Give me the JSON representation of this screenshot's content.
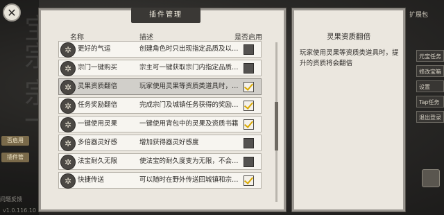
{
  "background": {
    "brush_text": "宝宗 宗一",
    "tag1": "否启用",
    "tag2": "插件管",
    "side_label": "问题反馈",
    "version": "v1.0.116.10",
    "right_top": "扩展包",
    "right_menu": [
      "元宝任务",
      "修改宝箱",
      "设置",
      "Tap任务",
      "退出登录"
    ]
  },
  "panel": {
    "title": "插件管理",
    "headers": {
      "name": "名称",
      "desc": "描述",
      "enabled": "是否启用"
    },
    "rows": [
      {
        "icon": "gear-icon",
        "name": "更好的气运",
        "desc": "创建角色时只出现指定品质及以上…",
        "checked": false,
        "selected": false
      },
      {
        "icon": "gear-icon",
        "name": "宗门一键购买",
        "desc": "宗主可一键获取宗门内指定品质…",
        "checked": false,
        "selected": false
      },
      {
        "icon": "gear-icon",
        "name": "灵果资质翻倍",
        "desc": "玩家使用灵果等资质类道具时，…",
        "checked": true,
        "selected": true
      },
      {
        "icon": "gear-icon",
        "name": "任务奖励翻倍",
        "desc": "完成宗门及城镇任务获得的奖励…",
        "checked": true,
        "selected": false
      },
      {
        "icon": "gear-icon",
        "name": "一键使用灵果",
        "desc": "一键使用背包中的灵果及资质书籍",
        "checked": true,
        "selected": false
      },
      {
        "icon": "gear-icon",
        "name": "多倍器灵好感",
        "desc": "增加获得器灵好感度",
        "checked": false,
        "selected": false
      },
      {
        "icon": "gear-icon",
        "name": "法宝耐久无限",
        "desc": "使法宝的耐久度变为无限，不会…",
        "checked": false,
        "selected": false
      },
      {
        "icon": "gear-icon",
        "name": "快捷传送",
        "desc": "可以随时在野外传送回城镇和宗…",
        "checked": true,
        "selected": false
      }
    ]
  },
  "detail": {
    "title": "灵果资质翻倍",
    "text": "玩家使用灵果等资质类道具时，提升的资质将会翻倍"
  },
  "colors": {
    "check": "#d9a800",
    "panel_bg": "#ebe7df",
    "banner": "#3a3835"
  }
}
